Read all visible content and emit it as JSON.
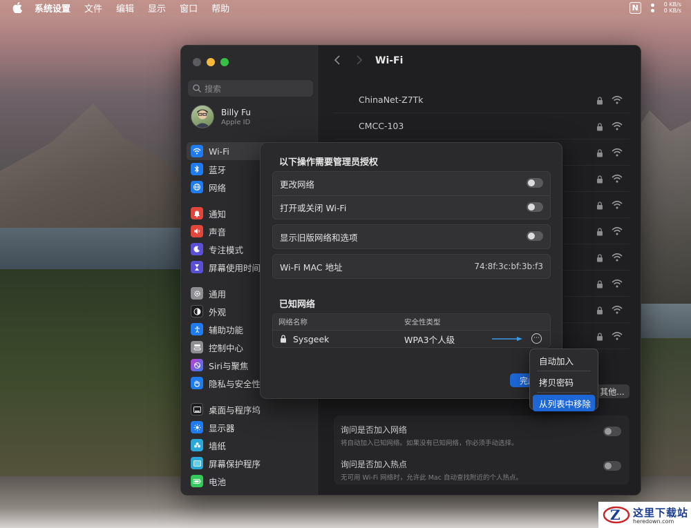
{
  "menubar": {
    "app": "系统设置",
    "items": [
      "文件",
      "编辑",
      "显示",
      "窗口",
      "帮助"
    ],
    "status_n": "N",
    "net_up": "0 KB/s",
    "net_down": "0 KB/s"
  },
  "sidebar": {
    "search_placeholder": "搜索",
    "user_name": "Billy Fu",
    "user_sub": "Apple ID",
    "groups": [
      [
        {
          "label": "Wi-Fi",
          "icon": "wifi-icon",
          "color": "#1e7cf0",
          "active": true
        },
        {
          "label": "蓝牙",
          "icon": "bluetooth-icon",
          "color": "#1e7cf0"
        },
        {
          "label": "网络",
          "icon": "globe-icon",
          "color": "#1e7cf0"
        }
      ],
      [
        {
          "label": "通知",
          "icon": "bell-icon",
          "color": "#e0463c"
        },
        {
          "label": "声音",
          "icon": "speaker-icon",
          "color": "#e0463c"
        },
        {
          "label": "专注模式",
          "icon": "moon-icon",
          "color": "#5b4fd6"
        },
        {
          "label": "屏幕使用时间",
          "icon": "hourglass-icon",
          "color": "#5b4fd6"
        }
      ],
      [
        {
          "label": "通用",
          "icon": "gear-icon",
          "color": "#8e8e93"
        },
        {
          "label": "外观",
          "icon": "appearance-icon",
          "color": "#1c1c1e"
        },
        {
          "label": "辅助功能",
          "icon": "accessibility-icon",
          "color": "#1e7cf0"
        },
        {
          "label": "控制中心",
          "icon": "control-center-icon",
          "color": "#8e8e93"
        },
        {
          "label": "Siri与聚焦",
          "icon": "siri-icon",
          "color": "#c03fd0"
        },
        {
          "label": "隐私与安全性",
          "icon": "hand-icon",
          "color": "#1e7cf0"
        }
      ],
      [
        {
          "label": "桌面与程序坞",
          "icon": "dock-icon",
          "color": "#1c1c1e"
        },
        {
          "label": "显示器",
          "icon": "sun-icon",
          "color": "#1e7cf0"
        },
        {
          "label": "墙纸",
          "icon": "flower-icon",
          "color": "#2aa9d8"
        },
        {
          "label": "屏幕保护程序",
          "icon": "screensaver-icon",
          "color": "#2aa9d8"
        },
        {
          "label": "电池",
          "icon": "battery-icon",
          "color": "#34c759"
        }
      ]
    ]
  },
  "content": {
    "title": "Wi-Fi",
    "networks": [
      "ChinaNet-Z7Tk",
      "CMCC-103",
      "",
      "",
      "",
      "",
      "",
      "",
      "",
      ""
    ],
    "others_label": "其他...",
    "ask_join": {
      "title": "询问是否加入网络",
      "desc": "将自动加入已知网络。如果没有已知网络，你必须手动选择。"
    },
    "ask_hotspot": {
      "title": "询问是否加入热点",
      "desc": "无可用 Wi-Fi 网络时，允许此 Mac 自动查找附近的个人热点。"
    }
  },
  "modal": {
    "title": "以下操作需要管理员授权",
    "row_change_network": "更改网络",
    "row_toggle_wifi": "打开或关闭 Wi-Fi",
    "row_legacy": "显示旧版网络和选项",
    "mac_label": "Wi-Fi MAC 地址",
    "mac_value": "74:8f:3c:bf:3b:f3",
    "known_title": "已知网络",
    "col_name": "网络名称",
    "col_security": "安全性类型",
    "known_networks": [
      {
        "name": "Sysgeek",
        "security": "WPA3个人级"
      }
    ],
    "more_glyph": "···",
    "done_label": "完成"
  },
  "context_menu": {
    "items": [
      "自动加入",
      "拷贝密码",
      "从列表中移除"
    ],
    "highlighted": 2
  },
  "watermark": {
    "cn": "这里下载站",
    "en": "heredown.com"
  }
}
